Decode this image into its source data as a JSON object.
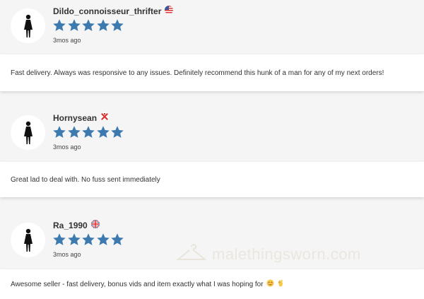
{
  "colors": {
    "star": "#3d7ab0",
    "card": "#ffffff",
    "page": "#f5f5f5"
  },
  "reviews": [
    {
      "username": "Dildo_connoisseur_thrifter",
      "flag": "us-flag-icon",
      "rating": 5,
      "time": "3mos ago",
      "text": "Fast delivery. Always was responsive to any issues. Definitely recommend this hunk of a man for any of my next orders!"
    },
    {
      "username": "Hornysean",
      "flag": "jersey-flag-icon",
      "rating": 5,
      "time": "3mos ago",
      "text": "Great lad to deal with. No fuss sent immediately"
    },
    {
      "username": "Ra_1990",
      "flag": "uk-flag-icon",
      "rating": 5,
      "time": "3mos ago",
      "text": "Awesome seller - fast delivery, bonus vids and item exactly what I was hoping for"
    }
  ],
  "watermark": "malethingsworn.com"
}
